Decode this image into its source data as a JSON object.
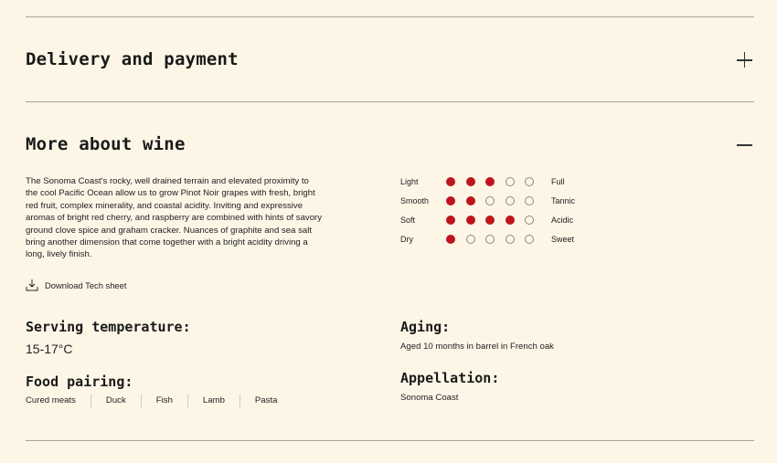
{
  "accordion": {
    "delivery": {
      "title": "Delivery and payment"
    },
    "more": {
      "title": "More about wine"
    }
  },
  "description": "The Sonoma Coast's rocky, well drained terrain and elevated proximity to the cool Pacific Ocean allow us to grow Pinot Noir grapes with fresh, bright red fruit, complex minerality, and coastal acidity. Inviting and expressive aromas of bright red cherry, and raspberry are combined with hints of savory ground clove spice and graham cracker. Nuances of graphite and sea salt bring another dimension that come together with a bright acidity driving a long, lively finish.",
  "download_label": "Download Tech sheet",
  "taste_scales": [
    {
      "left": "Light",
      "right": "Full",
      "level": 3,
      "max": 5
    },
    {
      "left": "Smooth",
      "right": "Tannic",
      "level": 2,
      "max": 5
    },
    {
      "left": "Soft",
      "right": "Acidic",
      "level": 4,
      "max": 5
    },
    {
      "left": "Dry",
      "right": "Sweet",
      "level": 1,
      "max": 5
    }
  ],
  "serving": {
    "title": "Serving temperature:",
    "value": "15-17°C"
  },
  "aging": {
    "title": "Aging:",
    "value": "Aged 10 months in barrel in French oak"
  },
  "food": {
    "title": "Food pairing:",
    "items": [
      "Cured meats",
      "Duck",
      "Fish",
      "Lamb",
      "Pasta"
    ]
  },
  "appellation": {
    "title": "Appellation:",
    "value": "Sonoma Coast"
  },
  "colors": {
    "background": "#fdf6e7",
    "dot_active": "#c0141c",
    "divider": "#a8a49c"
  },
  "icons": {
    "expand": "plus-icon",
    "collapse": "minus-icon",
    "download": "download-icon"
  }
}
